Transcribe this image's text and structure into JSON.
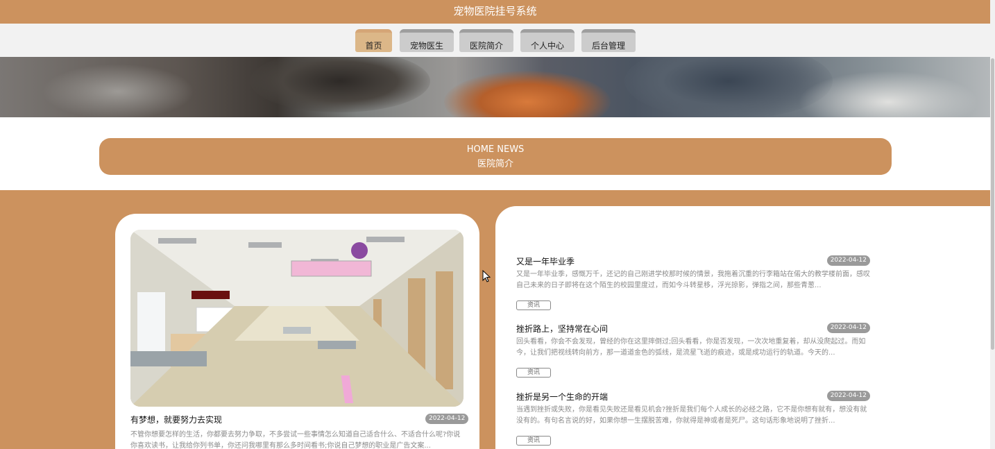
{
  "header": {
    "title": "宠物医院挂号系统"
  },
  "nav": {
    "items": [
      {
        "label": "首页",
        "active": true
      },
      {
        "label": "宠物医生",
        "active": false
      },
      {
        "label": "医院简介",
        "active": false
      },
      {
        "label": "个人中心",
        "active": false
      },
      {
        "label": "后台管理",
        "active": false
      }
    ]
  },
  "news_header": {
    "en": "HOME NEWS",
    "cn": "医院简介"
  },
  "featured": {
    "title": "有梦想，就要努力去实现",
    "date": "2022-04-12",
    "desc": "不管你想要怎样的生活，你都要去努力争取，不多尝试一些事情怎么知道自己适合什么、不适合什么呢?你说你喜欢读书，让我给你列书单，你还问我哪里有那么多时间看书;你说自己梦想的职业是广告文案..."
  },
  "news": [
    {
      "title": "又是一年毕业季",
      "date": "2022-04-12",
      "desc": "又是一年毕业季，感慨万千，还记的自己刚进学校那时候的情景，我拖着沉重的行李箱站在偌大的教学楼前面，感叹自己未来的日子即将在这个陌生的校园里度过，而如今斗转星移，浮光掠影，弹指之间，那些青葱...",
      "tag": "资讯"
    },
    {
      "title": "挫折路上，坚持常在心间",
      "date": "2022-04-12",
      "desc": "回头看看，你会不会发现，曾经的你在这里摔倒过;回头看看，你是否发现，一次次地重复着，却从没爬起过。而如今，让我们把视线转向前方，那一道道金色的弧线，是流星飞逝的痕迹，或是成功运行的轨道。今天的...",
      "tag": "资讯"
    },
    {
      "title": "挫折是另一个生命的开端",
      "date": "2022-04-12",
      "desc": "当遇到挫折或失败，你是看见失败还是看见机会?挫折是我们每个人成长的必经之路，它不是你想有就有，想没有就没有的。有句名言说的好，如果你想一生摆脱苦难，你就得是神或者是死尸。这句话形象地说明了挫折...",
      "tag": "资讯"
    }
  ],
  "colors": {
    "brand": "#cc925e",
    "active_nav": "#dcb788",
    "nav_bar": "#f2f2f2"
  },
  "icons": {
    "cursor": "arrow-cursor-icon"
  }
}
